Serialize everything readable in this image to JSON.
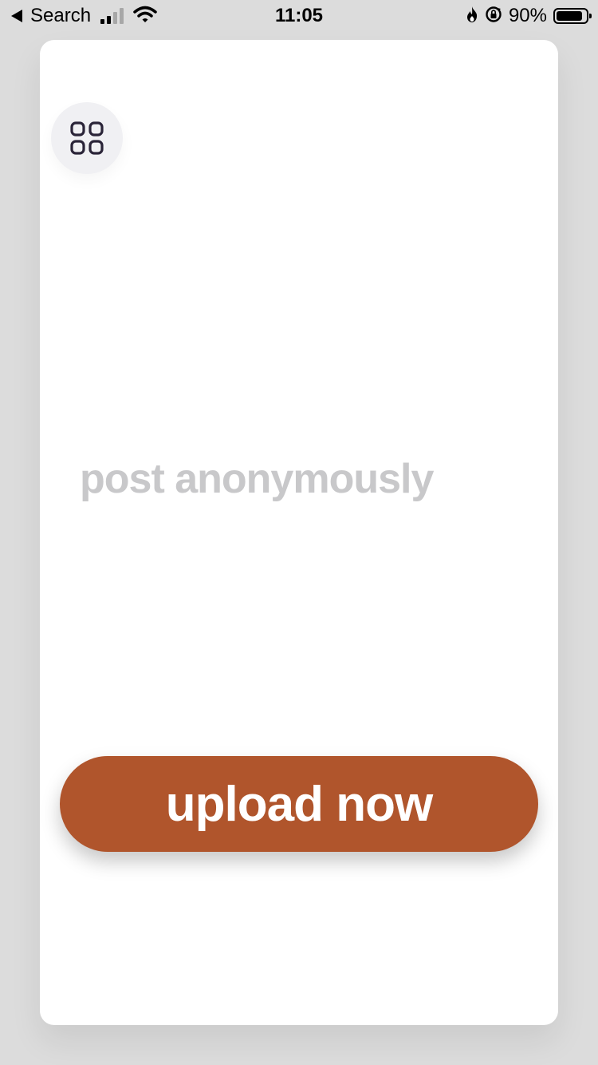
{
  "status_bar": {
    "back_label": "Search",
    "time": "11:05",
    "battery_percent": "90%",
    "battery_level": 0.9,
    "icons": [
      "back-arrow-icon",
      "cell-signal-icon",
      "wifi-icon",
      "flame-icon",
      "rotation-lock-icon",
      "battery-icon"
    ]
  },
  "card": {
    "menu_icon": "grid-icon",
    "tagline": "post anonymously",
    "upload_label": "upload now"
  },
  "colors": {
    "accent": "#b0552c",
    "tagline": "#c8c8ca",
    "background": "#dcdcdc",
    "menu_button": "#f0f0f3",
    "menu_icon": "#2a2438"
  }
}
